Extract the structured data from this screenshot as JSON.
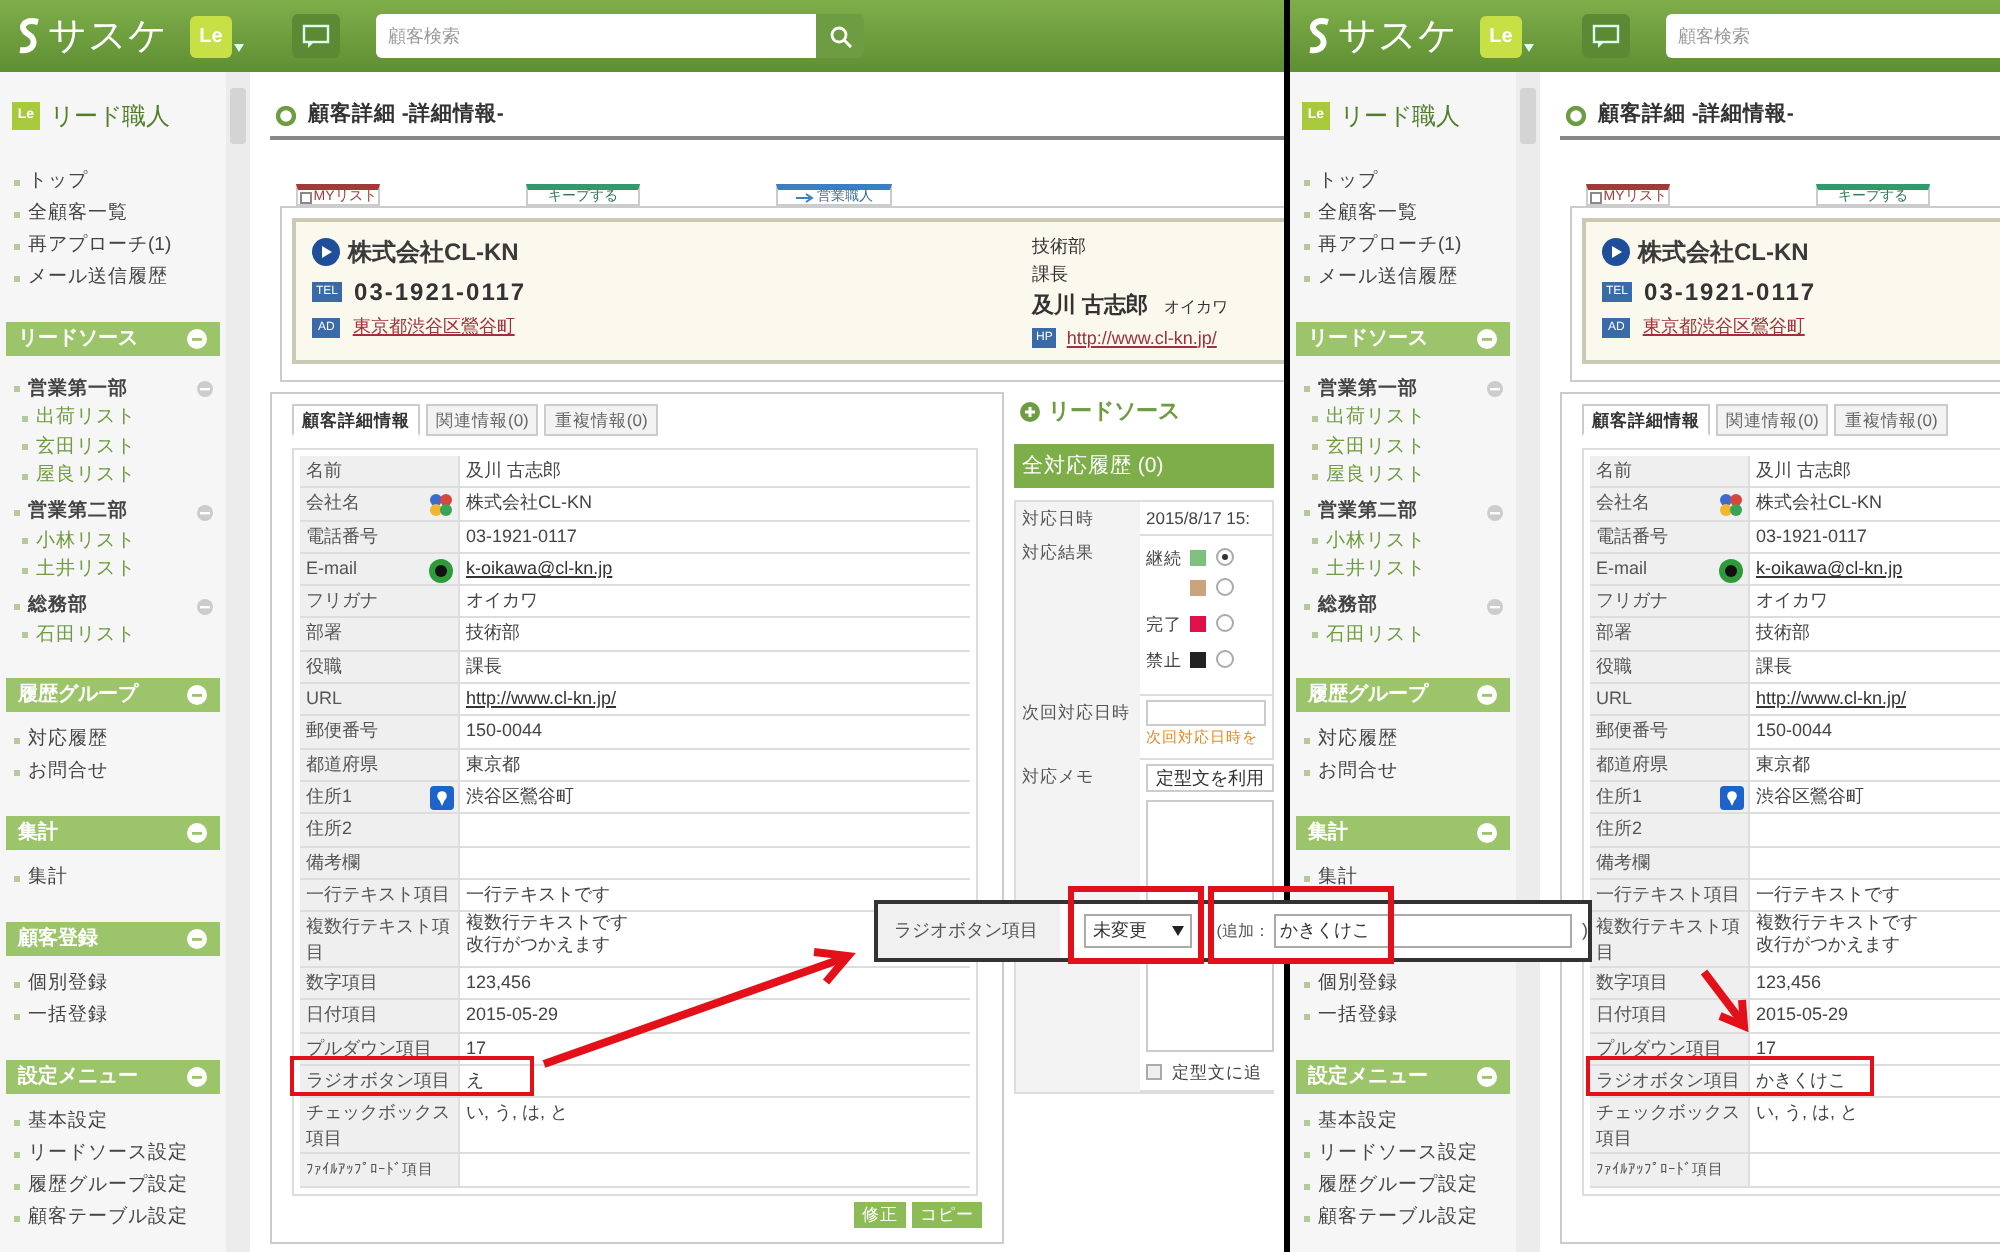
{
  "panels": [
    {
      "header": {
        "logo": "サスケ",
        "badge": "Le",
        "search_placeholder": "顧客検索"
      },
      "sidebar": {
        "badge": "Le",
        "title": "リード職人",
        "groups": [
          {
            "items": [
              {
                "label": "トップ",
                "kind": "link"
              },
              {
                "label": "全顧客一覧",
                "kind": "link"
              },
              {
                "label": "再アプローチ(1)",
                "kind": "link"
              },
              {
                "label": "メール送信履歴",
                "kind": "link"
              }
            ]
          },
          {
            "title": "リードソース",
            "items": [
              {
                "label": "営業第一部",
                "kind": "folder",
                "children": [
                  {
                    "label": "出荷リスト"
                  },
                  {
                    "label": "玄田リスト"
                  },
                  {
                    "label": "屋良リスト"
                  }
                ]
              },
              {
                "label": "営業第二部",
                "kind": "folder",
                "children": [
                  {
                    "label": "小林リスト"
                  },
                  {
                    "label": "土井リスト"
                  }
                ]
              },
              {
                "label": "総務部",
                "kind": "folder",
                "children": [
                  {
                    "label": "石田リスト"
                  }
                ]
              }
            ]
          },
          {
            "title": "履歴グループ",
            "items": [
              {
                "label": "対応履歴",
                "kind": "link"
              },
              {
                "label": "お問合せ",
                "kind": "link"
              }
            ]
          },
          {
            "title": "集計",
            "items": [
              {
                "label": "集計",
                "kind": "link"
              }
            ]
          },
          {
            "title": "顧客登録",
            "items": [
              {
                "label": "個別登録",
                "kind": "link"
              },
              {
                "label": "一括登録",
                "kind": "link"
              }
            ]
          },
          {
            "title": "設定メニュー",
            "items": [
              {
                "label": "基本設定",
                "kind": "link"
              },
              {
                "label": "リードソース設定",
                "kind": "link"
              },
              {
                "label": "履歴グループ設定",
                "kind": "link"
              },
              {
                "label": "顧客テーブル設定",
                "kind": "link"
              }
            ]
          }
        ]
      },
      "title": "顧客詳細 -詳細情報-",
      "action_tabs": [
        {
          "label": "MYリスト",
          "kind": "mylist",
          "checked": false
        },
        {
          "label": "キープする",
          "kind": "keep"
        },
        {
          "label": "営業職人",
          "kind": "sales"
        }
      ],
      "card": {
        "company": "株式会社CL-KN",
        "tel_icon": "TEL",
        "phone": "03-1921-0117",
        "address_icon": "AD",
        "address": "東京都渋谷区鶯谷町",
        "department": "技術部",
        "position": "課長",
        "name": "及川 古志郎",
        "kana": "オイカワ",
        "url_icon": "HP",
        "url": "http://www.cl-kn.jp/"
      },
      "detail_tabs": [
        {
          "label": "顧客詳細情報",
          "selected": true
        },
        {
          "label": "関連情報(0)",
          "selected": false
        },
        {
          "label": "重複情報(0)",
          "selected": false
        }
      ],
      "rows": [
        {
          "label": "名前",
          "value": "及川 古志郎",
          "kind": "plain"
        },
        {
          "label": "会社名",
          "value": "株式会社CL-KN",
          "kind": "company"
        },
        {
          "label": "電話番号",
          "value": "03-1921-0117",
          "kind": "plain"
        },
        {
          "label": "E-mail",
          "value": "k-oikawa@cl-kn.jp",
          "kind": "email"
        },
        {
          "label": "フリガナ",
          "value": "オイカワ",
          "kind": "plain"
        },
        {
          "label": "部署",
          "value": "技術部",
          "kind": "plain"
        },
        {
          "label": "役職",
          "value": "課長",
          "kind": "plain"
        },
        {
          "label": "URL",
          "value": "http://www.cl-kn.jp/",
          "kind": "url"
        },
        {
          "label": "郵便番号",
          "value": "150-0044",
          "kind": "plain"
        },
        {
          "label": "都道府県",
          "value": "東京都",
          "kind": "plain"
        },
        {
          "label": "住所1",
          "value": "渋谷区鶯谷町",
          "kind": "address"
        },
        {
          "label": "住所2",
          "kind": "plain"
        },
        {
          "label": "備考欄",
          "kind": "plain"
        },
        {
          "label": "一行テキスト項目",
          "value": "一行テキストです",
          "kind": "plain"
        },
        {
          "label": "複数行テキスト項目",
          "value_lines": [
            "複数行テキストです",
            "改行がつかえます"
          ],
          "kind": "multiline"
        },
        {
          "label": "数字項目",
          "value": "123,456",
          "kind": "plain"
        },
        {
          "label": "日付項目",
          "value": "2015-05-29",
          "kind": "plain"
        },
        {
          "label": "プルダウン項目",
          "value": "17",
          "kind": "plain"
        },
        {
          "label": "ラジオボタン項目",
          "value": "え",
          "kind": "plain"
        },
        {
          "label": "チェックボックス項目",
          "value": "い, う, は, と",
          "kind": "plain"
        },
        {
          "label": "ﾌｧｲﾙｱｯﾌﾟﾛｰﾄﾞ項目",
          "kind": "plain"
        }
      ],
      "buttons": [
        "修正",
        "コピー"
      ],
      "side": {
        "heading": "リードソース",
        "history_title": "全対応履歴 (0)",
        "date_label": "対応日時",
        "date_value": "2015/8/17 15:",
        "result_label": "対応結果",
        "results": [
          {
            "label": "継続",
            "color": "#7fc07f",
            "selected": true
          },
          {
            "color": "#c9a27e",
            "selected": false
          },
          {
            "label": "完了",
            "color": "#e0104a",
            "selected": false
          },
          {
            "label": "禁止",
            "color": "#222222",
            "selected": false
          }
        ],
        "next_label": "次回対応日時",
        "next_hint": "次回対応日時を",
        "memo_label": "対応メモ",
        "memo_select": "定型文を利用",
        "memo_check": "定型文に追",
        "memo_checked": false
      }
    },
    {
      "header": {
        "logo": "サスケ",
        "badge": "Le",
        "search_placeholder": "顧客検索"
      },
      "sidebar": {
        "badge": "Le",
        "title": "リード職人",
        "groups": [
          {
            "items": [
              {
                "label": "トップ",
                "kind": "link"
              },
              {
                "label": "全顧客一覧",
                "kind": "link"
              },
              {
                "label": "再アプローチ(1)",
                "kind": "link"
              },
              {
                "label": "メール送信履歴",
                "kind": "link"
              }
            ]
          },
          {
            "title": "リードソース",
            "items": [
              {
                "label": "営業第一部",
                "kind": "folder",
                "children": [
                  {
                    "label": "出荷リスト"
                  },
                  {
                    "label": "玄田リスト"
                  },
                  {
                    "label": "屋良リスト"
                  }
                ]
              },
              {
                "label": "営業第二部",
                "kind": "folder",
                "children": [
                  {
                    "label": "小林リスト"
                  },
                  {
                    "label": "土井リスト"
                  }
                ]
              },
              {
                "label": "総務部",
                "kind": "folder",
                "children": [
                  {
                    "label": "石田リスト"
                  }
                ]
              }
            ]
          },
          {
            "title": "履歴グループ",
            "items": [
              {
                "label": "対応履歴",
                "kind": "link"
              },
              {
                "label": "お問合せ",
                "kind": "link"
              }
            ]
          },
          {
            "title": "集計",
            "items": [
              {
                "label": "集計",
                "kind": "link"
              }
            ]
          },
          {
            "items": [
              {
                "label": "個別登録",
                "kind": "link"
              },
              {
                "label": "一括登録",
                "kind": "link"
              }
            ]
          },
          {
            "title": "設定メニュー",
            "items": [
              {
                "label": "基本設定",
                "kind": "link"
              },
              {
                "label": "リードソース設定",
                "kind": "link"
              },
              {
                "label": "履歴グループ設定",
                "kind": "link"
              },
              {
                "label": "顧客テーブル設定",
                "kind": "link"
              }
            ]
          }
        ]
      },
      "title": "顧客詳細 -詳細情報-",
      "action_tabs": [
        {
          "label": "MYリスト",
          "kind": "mylist",
          "checked": false
        },
        {
          "label": "キープする",
          "kind": "keep"
        }
      ],
      "card": {
        "company": "株式会社CL-KN",
        "tel_icon": "TEL",
        "phone": "03-1921-0117",
        "address_icon": "AD",
        "address": "東京都渋谷区鶯谷町"
      },
      "detail_tabs": [
        {
          "label": "顧客詳細情報",
          "selected": true
        },
        {
          "label": "関連情報(0)",
          "selected": false
        },
        {
          "label": "重複情報(0)",
          "selected": false
        }
      ],
      "rows": [
        {
          "label": "名前",
          "value": "及川 古志郎",
          "kind": "plain"
        },
        {
          "label": "会社名",
          "value": "株式会社CL-KN",
          "kind": "company"
        },
        {
          "label": "電話番号",
          "value": "03-1921-0117",
          "kind": "plain"
        },
        {
          "label": "E-mail",
          "value": "k-oikawa@cl-kn.jp",
          "kind": "email"
        },
        {
          "label": "フリガナ",
          "value": "オイカワ",
          "kind": "plain"
        },
        {
          "label": "部署",
          "value": "技術部",
          "kind": "plain"
        },
        {
          "label": "役職",
          "value": "課長",
          "kind": "plain"
        },
        {
          "label": "URL",
          "value": "http://www.cl-kn.jp/",
          "kind": "url"
        },
        {
          "label": "郵便番号",
          "value": "150-0044",
          "kind": "plain"
        },
        {
          "label": "都道府県",
          "value": "東京都",
          "kind": "plain"
        },
        {
          "label": "住所1",
          "value": "渋谷区鶯谷町",
          "kind": "address"
        },
        {
          "label": "住所2",
          "kind": "plain"
        },
        {
          "label": "備考欄",
          "kind": "plain"
        },
        {
          "label": "一行テキスト項目",
          "value": "一行テキストです",
          "kind": "plain"
        },
        {
          "label": "複数行テキスト項目",
          "value_lines": [
            "複数行テキストです",
            "改行がつかえます"
          ],
          "kind": "multiline"
        },
        {
          "label": "数字項目",
          "value": "123,456",
          "kind": "plain"
        },
        {
          "label": "日付項目",
          "value": "2015-05-29",
          "kind": "plain"
        },
        {
          "label": "プルダウン項目",
          "value": "17",
          "kind": "plain"
        },
        {
          "label": "ラジオボタン項目",
          "value": "かきくけこ",
          "kind": "plain"
        },
        {
          "label": "チェックボックス項目",
          "value": "い, う, は, と",
          "kind": "plain"
        },
        {
          "label": "ﾌｧｲﾙｱｯﾌﾟﾛｰﾄﾞ項目",
          "kind": "plain"
        }
      ]
    }
  ],
  "popup": {
    "label": "ラジオボタン項目",
    "select": "未変更",
    "prefix": "(追加：",
    "value": "かきくけこ",
    "suffix": ")"
  }
}
